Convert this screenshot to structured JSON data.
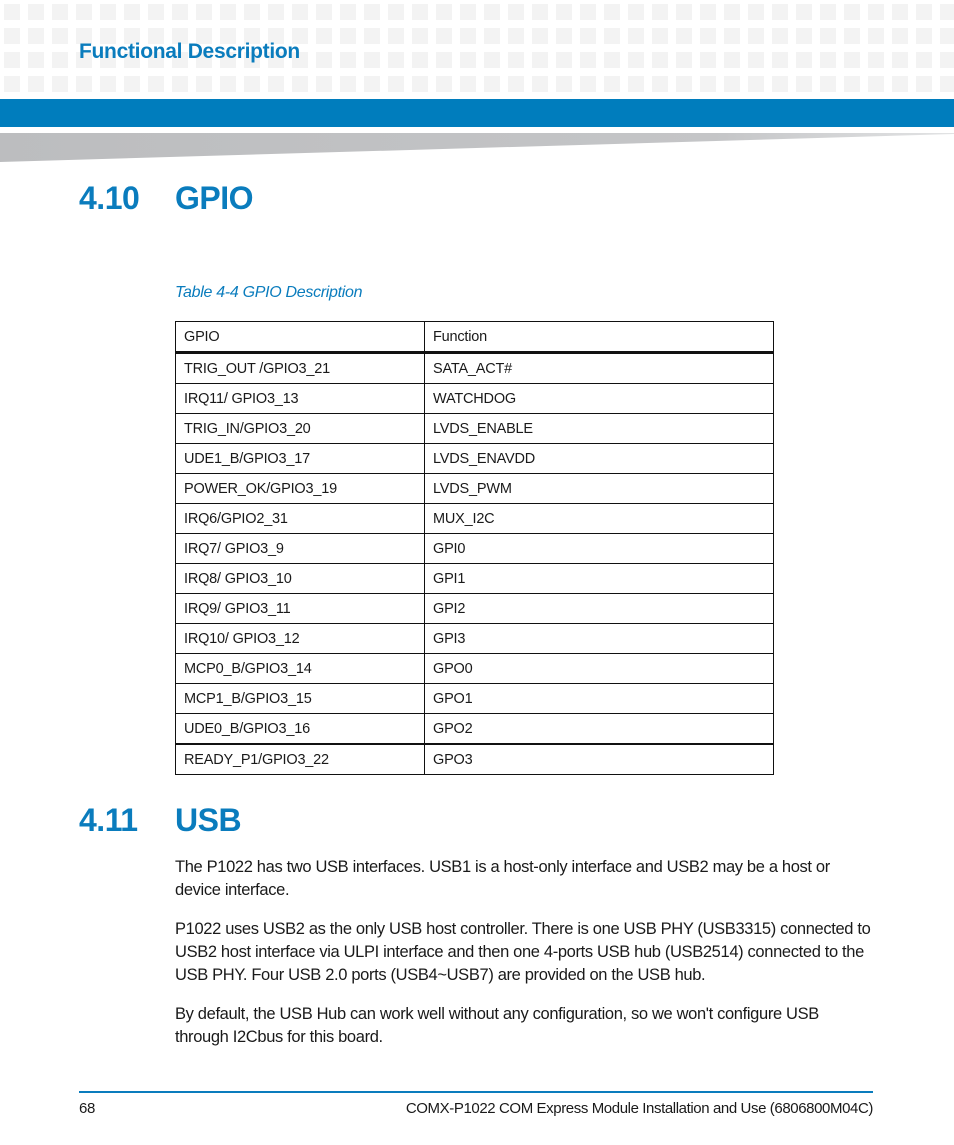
{
  "header": {
    "chapter_title": "Functional Description",
    "accent_color": "#007dbd"
  },
  "sections": [
    {
      "number": "4.10",
      "title": "GPIO"
    },
    {
      "number": "4.11",
      "title": "USB"
    }
  ],
  "gpio_table": {
    "caption": "Table 4-4 GPIO Description",
    "headers": [
      "GPIO",
      "Function"
    ],
    "rows": [
      [
        "TRIG_OUT /GPIO3_21",
        "SATA_ACT#"
      ],
      [
        "IRQ11/ GPIO3_13",
        "WATCHDOG"
      ],
      [
        "TRIG_IN/GPIO3_20",
        "LVDS_ENABLE"
      ],
      [
        "UDE1_B/GPIO3_17",
        "LVDS_ENAVDD"
      ],
      [
        "POWER_OK/GPIO3_19",
        "LVDS_PWM"
      ],
      [
        "IRQ6/GPIO2_31",
        "MUX_I2C"
      ],
      [
        "IRQ7/ GPIO3_9",
        "GPI0"
      ],
      [
        "IRQ8/ GPIO3_10",
        "GPI1"
      ],
      [
        "IRQ9/ GPIO3_11",
        "GPI2"
      ],
      [
        "IRQ10/ GPIO3_12",
        "GPI3"
      ],
      [
        "MCP0_B/GPIO3_14",
        "GPO0"
      ],
      [
        "MCP1_B/GPIO3_15",
        "GPO1"
      ],
      [
        "UDE0_B/GPIO3_16",
        "GPO2"
      ],
      [
        "READY_P1/GPIO3_22",
        "GPO3"
      ]
    ]
  },
  "usb": {
    "paragraphs": [
      "The P1022 has two USB interfaces. USB1 is a host-only interface and USB2 may be a host or device interface.",
      "P1022 uses USB2 as the only USB host controller. There is one USB PHY (USB3315) connected to USB2 host interface via ULPI interface and then one 4-ports USB hub (USB2514) connected to the USB PHY.  Four USB 2.0 ports (USB4~USB7) are provided on the USB hub.",
      "By default, the USB Hub can work well without any configuration, so we won't configure USB through I2Cbus for this board."
    ]
  },
  "footer": {
    "page_number": "68",
    "document_title": "COMX-P1022 COM Express Module Installation and Use (6806800M04C)"
  }
}
